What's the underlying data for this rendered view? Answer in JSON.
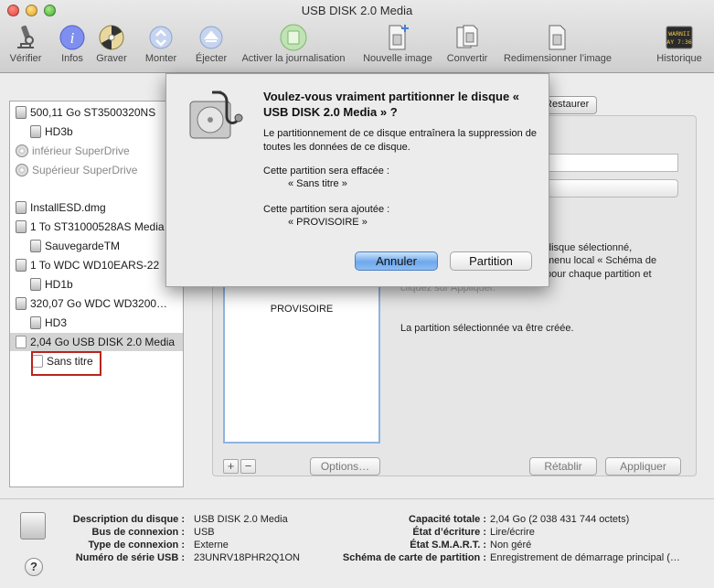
{
  "window": {
    "title": "USB DISK 2.0 Media"
  },
  "toolbar": {
    "items": [
      {
        "label": "Vérifier",
        "icon": "microscope-icon"
      },
      {
        "label": "Infos",
        "icon": "info-icon"
      },
      {
        "label": "Graver",
        "icon": "burn-icon"
      },
      {
        "label": "Monter",
        "icon": "mount-icon"
      },
      {
        "label": "Éjecter",
        "icon": "eject-icon"
      },
      {
        "label": "Activer la journalisation",
        "icon": "journal-icon"
      },
      {
        "label": "Nouvelle image",
        "icon": "new-image-icon"
      },
      {
        "label": "Convertir",
        "icon": "convert-icon"
      },
      {
        "label": "Redimensionner l’image",
        "icon": "resize-image-icon"
      },
      {
        "label": "Historique",
        "icon": "log-icon"
      }
    ],
    "log_badge": "WARNII\nAY 7:36"
  },
  "sidebar": {
    "items": [
      {
        "label": "500,11 Go ST3500320NS",
        "indent": 0,
        "icon": "disk"
      },
      {
        "label": "HD3b",
        "indent": 1,
        "icon": "disk"
      },
      {
        "label": "inférieur SuperDrive",
        "indent": 0,
        "icon": "cd",
        "muted": true
      },
      {
        "label": "Supérieur SuperDrive",
        "indent": 0,
        "icon": "cd",
        "muted": true
      },
      {
        "label": "InstallESD.dmg",
        "indent": 0,
        "icon": "disk"
      },
      {
        "label": "1 To ST31000528AS Media",
        "indent": 0,
        "icon": "disk"
      },
      {
        "label": "SauvegardeTM",
        "indent": 1,
        "icon": "disk"
      },
      {
        "label": "1 To WDC WD10EARS-22",
        "indent": 0,
        "icon": "disk"
      },
      {
        "label": "HD1b",
        "indent": 1,
        "icon": "disk"
      },
      {
        "label": "320,07 Go WDC WD3200…",
        "indent": 0,
        "icon": "disk"
      },
      {
        "label": "HD3",
        "indent": 1,
        "icon": "disk"
      },
      {
        "label": "2,04 Go USB DISK 2.0 Media",
        "indent": 0,
        "icon": "white",
        "selected": true
      },
      {
        "label": "Sans titre",
        "indent": 1,
        "icon": "white"
      }
    ]
  },
  "tabs": {
    "restore": "Restaurer"
  },
  "partition_panel": {
    "layout_name": "PROVISOIRE",
    "info_text_1": "disque sélectionné,",
    "info_text_2": "menu local « Schéma de",
    "info_text_3": "pour chaque partition et",
    "info_text_4": "cliquez sur Appliquer.",
    "info_text_5": "La partition sélectionnée va être créée.",
    "options_label": "Options…",
    "revert_label": "Rétablir",
    "apply_label": "Appliquer",
    "plus_label": "+",
    "minus_label": "−"
  },
  "dialog": {
    "title": "Voulez-vous vraiment partitionner le disque « USB DISK 2.0 Media » ?",
    "body": "Le partitionnement de ce disque entraînera la suppression de toutes les données de ce disque.",
    "erase_label": "Cette partition sera effacée :",
    "erase_value": "« Sans titre  »",
    "add_label": "Cette partition sera ajoutée :",
    "add_value": "« PROVISOIRE »",
    "cancel_label": "Annuler",
    "partition_label": "Partition"
  },
  "disk_info": {
    "left": [
      {
        "label": "Description du disque :",
        "value": "USB DISK 2.0 Media"
      },
      {
        "label": "Bus de connexion :",
        "value": "USB"
      },
      {
        "label": "Type de connexion :",
        "value": "Externe"
      },
      {
        "label": "Numéro de série USB :",
        "value": "23UNRV18PHR2Q1ON"
      }
    ],
    "right": [
      {
        "label": "Capacité totale :",
        "value": "2,04 Go (2 038 431 744 octets)"
      },
      {
        "label": "État d’écriture :",
        "value": "Lire/écrire"
      },
      {
        "label": "État S.M.A.R.T. :",
        "value": "Non géré"
      },
      {
        "label": "Schéma de carte de partition :",
        "value": "Enregistrement de démarrage principal (…"
      }
    ]
  },
  "help_label": "?",
  "colors": {
    "default_button": "#6ea8ec",
    "highlight": "#b8251d"
  }
}
